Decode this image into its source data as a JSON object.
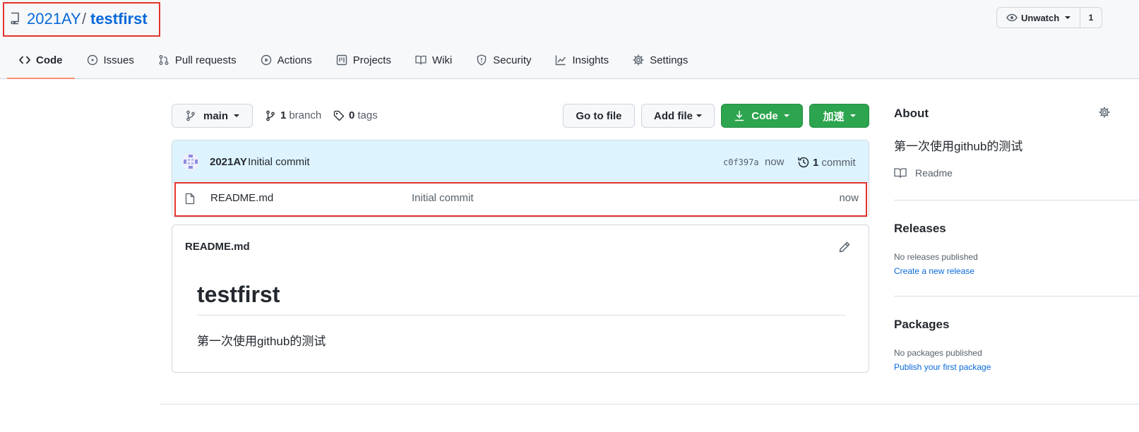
{
  "repo": {
    "owner": "2021AY",
    "separator": "/",
    "name": "testfirst"
  },
  "watch": {
    "label": "Unwatch",
    "count": "1"
  },
  "tabs": [
    {
      "label": "Code",
      "icon": "code-icon",
      "selected": true
    },
    {
      "label": "Issues",
      "icon": "issue-icon"
    },
    {
      "label": "Pull requests",
      "icon": "pull-request-icon"
    },
    {
      "label": "Actions",
      "icon": "play-icon"
    },
    {
      "label": "Projects",
      "icon": "project-icon"
    },
    {
      "label": "Wiki",
      "icon": "book-icon"
    },
    {
      "label": "Security",
      "icon": "shield-icon"
    },
    {
      "label": "Insights",
      "icon": "graph-icon"
    },
    {
      "label": "Settings",
      "icon": "gear-icon"
    }
  ],
  "toolbar": {
    "branch": "main",
    "branch_count": "1",
    "branch_label": "branch",
    "tag_count": "0",
    "tag_label": "tags",
    "go_to_file": "Go to file",
    "add_file": "Add file",
    "code": "Code",
    "accelerate": "加速"
  },
  "commit": {
    "author": "2021AY",
    "message": "Initial commit",
    "sha": "c0f397a",
    "time": "now",
    "count": "1",
    "count_label": "commit"
  },
  "files": [
    {
      "name": "README.md",
      "message": "Initial commit",
      "time": "now"
    }
  ],
  "readme": {
    "filename": "README.md",
    "heading": "testfirst",
    "body": "第一次使用github的测试"
  },
  "sidebar": {
    "about_title": "About",
    "description": "第一次使用github的测试",
    "readme_link": "Readme",
    "releases_title": "Releases",
    "releases_empty": "No releases published",
    "releases_link": "Create a new release",
    "packages_title": "Packages",
    "packages_empty": "No packages published",
    "packages_link": "Publish your first package"
  },
  "colors": {
    "link": "#0969da",
    "green": "#2da44e",
    "highlight_border": "#e5342e",
    "tab_underline": "#fd8c73"
  }
}
